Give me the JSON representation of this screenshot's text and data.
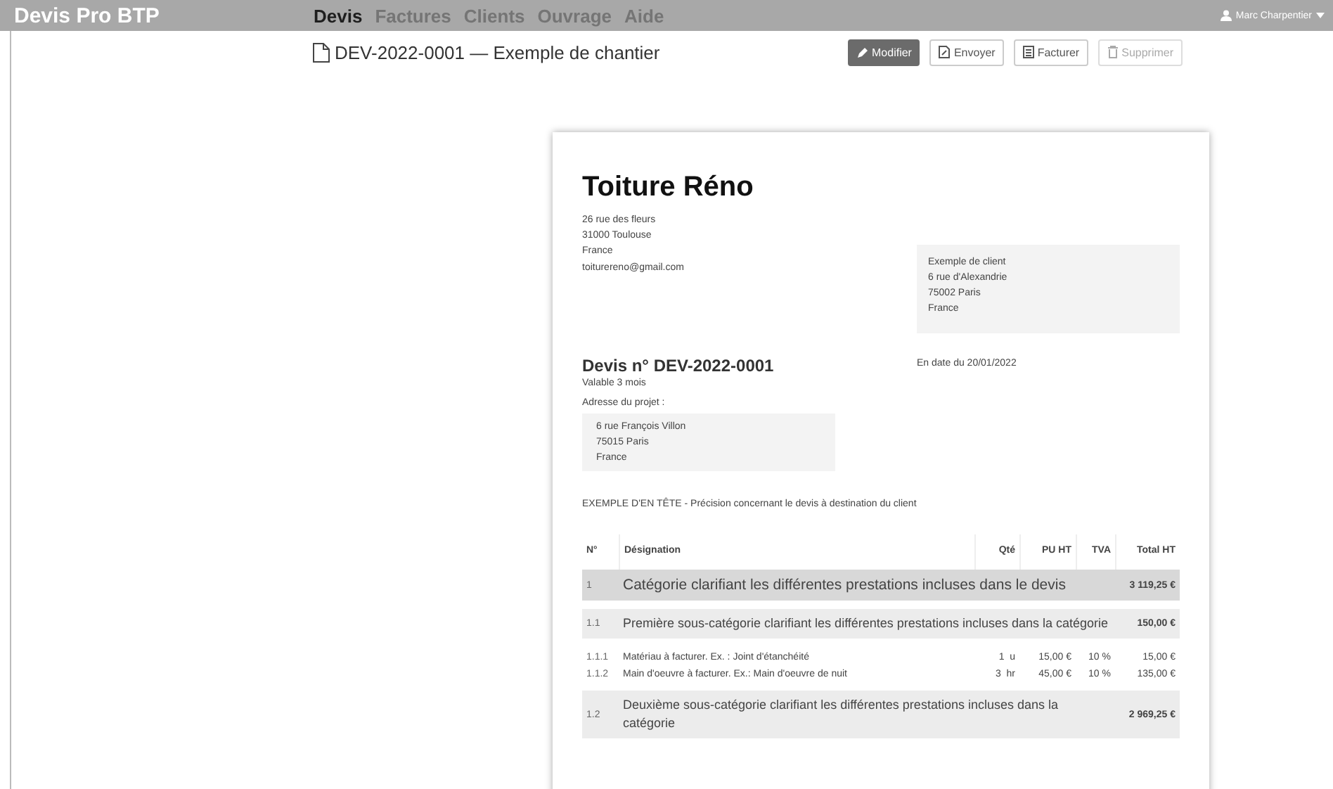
{
  "app_title": "Devis Pro BTP",
  "nav": [
    {
      "label": "Devis",
      "selected": true
    },
    {
      "label": "Factures",
      "selected": false
    },
    {
      "label": "Clients",
      "selected": false
    },
    {
      "label": "Ouvrage",
      "selected": false
    },
    {
      "label": "Aide",
      "selected": false
    }
  ],
  "user": {
    "name": "Marc Charpentier"
  },
  "document_title": "DEV-2022-0001 — Exemple de chantier",
  "actions": [
    {
      "label": "Modifier",
      "kind": "edit",
      "primary": true,
      "disabled": false
    },
    {
      "label": "Envoyer",
      "kind": "send",
      "primary": false,
      "disabled": false
    },
    {
      "label": "Facturer",
      "kind": "invoice",
      "primary": false,
      "disabled": false
    },
    {
      "label": "Supprimer",
      "kind": "delete",
      "primary": false,
      "disabled": true
    }
  ],
  "quote": {
    "company": {
      "name": "Toiture Réno",
      "address_lines": [
        "26 rue des fleurs",
        "31000 Toulouse",
        "France"
      ],
      "email": "toiturereno@gmail.com"
    },
    "client": {
      "lines": [
        "Exemple de client",
        "6 rue d'Alexandrie",
        "75002 Paris",
        "France"
      ]
    },
    "number": "Devis n° DEV-2022-0001",
    "validity": "Valable 3 mois",
    "date": "En date du 20/01/2022",
    "project_address_label": "Adresse du projet :",
    "project_address_lines": [
      "6 rue François Villon",
      "75015 Paris",
      "France"
    ],
    "header_note": "EXEMPLE D'EN TÊTE - Précision concernant le devis à destination du client",
    "table": {
      "columns": [
        "N°",
        "Désignation",
        "Qté",
        "PU HT",
        "TVA",
        "Total HT"
      ],
      "rows": [
        {
          "kind": "category",
          "number": "1",
          "designation": "Catégorie clarifiant les différentes prestations incluses dans le devis",
          "total": "3 119,25 €"
        },
        {
          "kind": "subcategory",
          "number": "1.1",
          "designation": "Première sous-catégorie clarifiant les différentes prestations incluses dans la catégorie",
          "total": "150,00 €"
        },
        {
          "kind": "item",
          "number": "1.1.1",
          "designation": "Matériau à facturer. Ex. : Joint d'étanchéité",
          "qty": "1",
          "unit": "u",
          "unit_price": "15,00 €",
          "vat": "10 %",
          "total": "15,00 €"
        },
        {
          "kind": "item",
          "number": "1.1.2",
          "designation": "Main d'oeuvre à facturer. Ex.: Main d'oeuvre de nuit",
          "qty": "3",
          "unit": "hr",
          "unit_price": "45,00 €",
          "vat": "10 %",
          "total": "135,00 €"
        },
        {
          "kind": "subcategory",
          "number": "1.2",
          "designation": "Deuxième sous-catégorie clarifiant les différentes prestations incluses dans la catégorie",
          "total": "2 969,25 €"
        }
      ]
    }
  }
}
